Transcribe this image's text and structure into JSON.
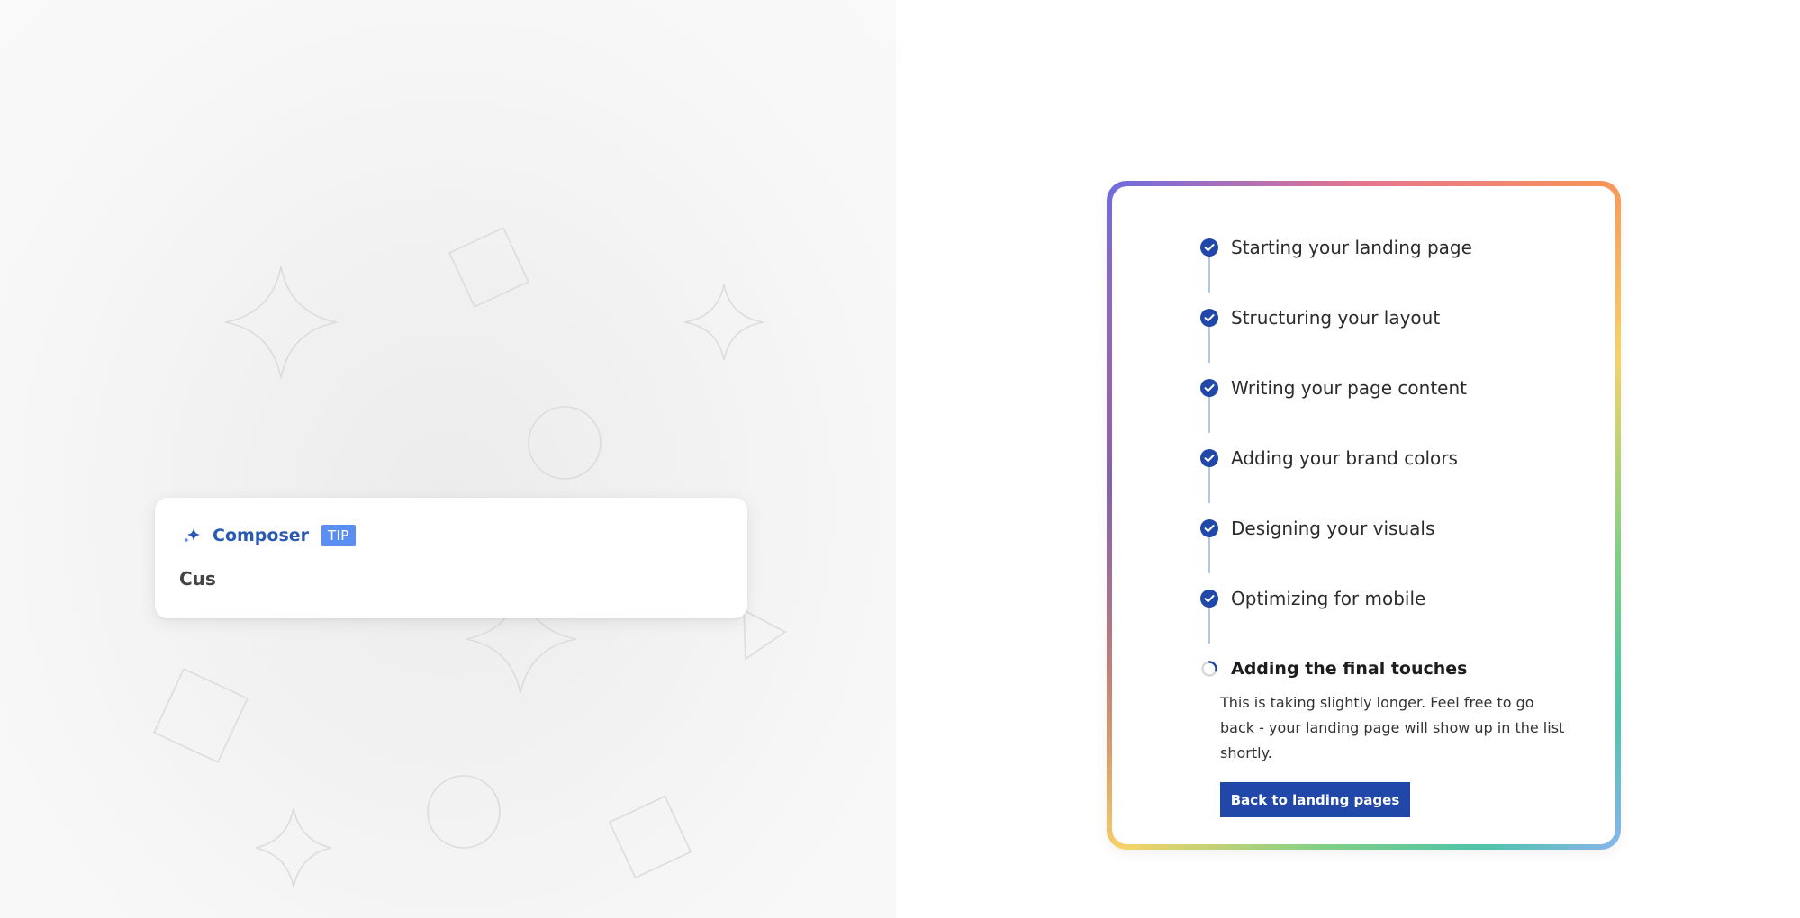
{
  "tip_card": {
    "icon": "sparkle-icon",
    "title": "Composer",
    "badge": "TIP",
    "text": "Cus"
  },
  "progress": {
    "steps": [
      {
        "label": "Starting your landing page",
        "status": "done"
      },
      {
        "label": "Structuring your layout",
        "status": "done"
      },
      {
        "label": "Writing your page content",
        "status": "done"
      },
      {
        "label": "Adding your brand colors",
        "status": "done"
      },
      {
        "label": "Designing your visuals",
        "status": "done"
      },
      {
        "label": "Optimizing for mobile",
        "status": "done"
      },
      {
        "label": "Adding the final touches",
        "status": "in-progress"
      }
    ],
    "note": "This is taking slightly longer. Feel free to go back - your landing page will show up in the list shortly.",
    "back_button": "Back to landing pages"
  },
  "colors": {
    "primary": "#2148a8",
    "composer": "#2a5bb4",
    "badge": "#5a8ef1"
  }
}
